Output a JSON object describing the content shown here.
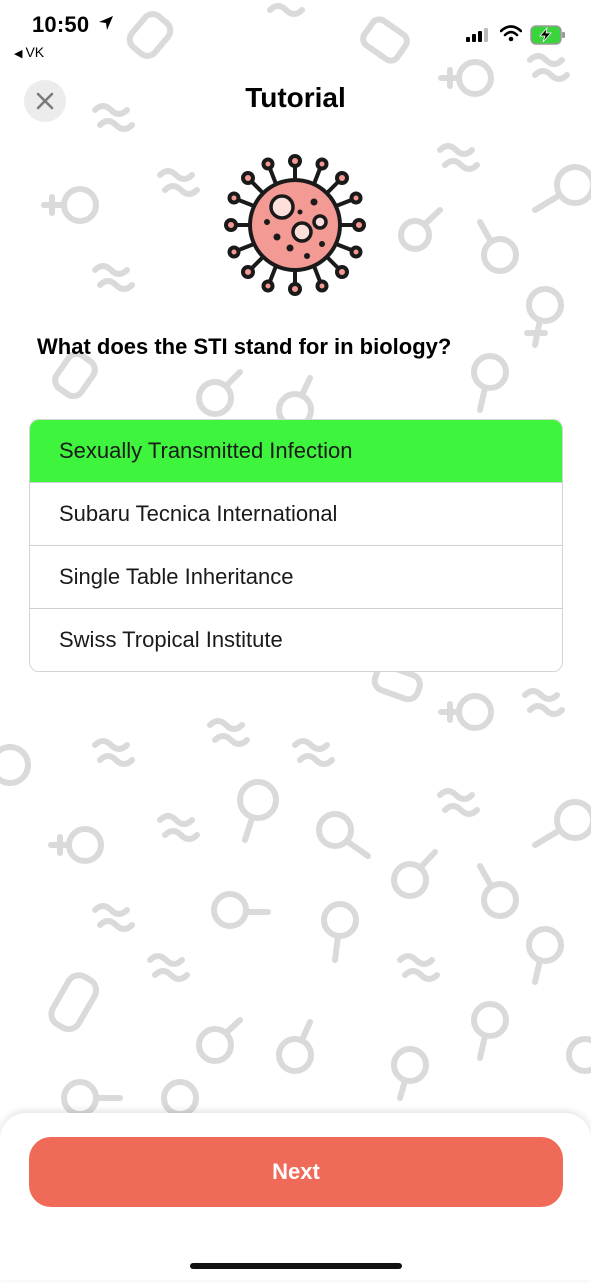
{
  "status_bar": {
    "time": "10:50",
    "back_app": "VK",
    "icons": [
      "location-arrow-icon",
      "signal-icon",
      "wifi-icon",
      "battery-charging-icon"
    ]
  },
  "header": {
    "title": "Tutorial",
    "close_icon": "close-icon"
  },
  "illustration": "virus-icon",
  "quiz": {
    "question": "What does the STI stand for in biology?",
    "options": [
      {
        "label": "Sexually Transmitted Infection",
        "state": "correct"
      },
      {
        "label": "Subaru Tecnica International",
        "state": "default"
      },
      {
        "label": "Single Table Inheritance",
        "state": "default"
      },
      {
        "label": "Swiss Tropical Institute",
        "state": "default"
      }
    ]
  },
  "footer": {
    "next_label": "Next"
  },
  "colors": {
    "correct": "#3ef43c",
    "primary_button": "#f06a5a",
    "virus": "#f49a94",
    "background_pattern": "#dcdcdc"
  }
}
